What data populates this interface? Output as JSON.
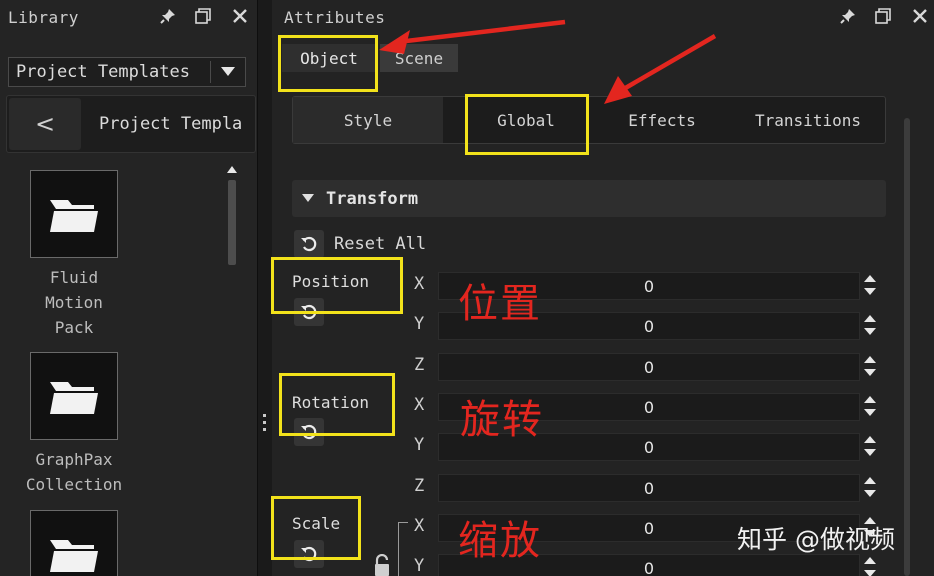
{
  "library": {
    "title": "Library",
    "dropdown_value": "Project Templates",
    "back_label": "<",
    "path": "Project Templa",
    "items": [
      {
        "label": "Fluid\nMotion\nPack",
        "icon": "folder-icon"
      },
      {
        "label": "GraphPax\nCollection",
        "icon": "folder-icon"
      },
      {
        "label": "",
        "icon": "folder-icon"
      }
    ]
  },
  "attributes": {
    "title": "Attributes",
    "tabs": {
      "object": "Object",
      "scene": "Scene"
    },
    "subtabs": {
      "style": "Style",
      "global": "Global",
      "effects": "Effects",
      "transitions": "Transitions"
    },
    "section_title": "Transform",
    "reset_all": "Reset All",
    "groups": {
      "position": "Position",
      "rotation": "Rotation",
      "scale": "Scale"
    },
    "rows": [
      {
        "axis": "X",
        "value": "0"
      },
      {
        "axis": "Y",
        "value": "0"
      },
      {
        "axis": "Z",
        "value": "0"
      },
      {
        "axis": "X",
        "value": "0"
      },
      {
        "axis": "Y",
        "value": "0"
      },
      {
        "axis": "Z",
        "value": "0"
      },
      {
        "axis": "X",
        "value": "0"
      },
      {
        "axis": "Y",
        "value": "0"
      }
    ]
  },
  "annotations": {
    "position_cn": "位置",
    "rotation_cn": "旋转",
    "scale_cn": "缩放",
    "highlight_color": "#f2e21b",
    "arrow_color": "#e3261f"
  },
  "watermark": "知乎 @做视频",
  "icons": {
    "pin": "pin-icon",
    "float": "float-window-icon",
    "close": "close-icon",
    "reset": "reset-icon",
    "lock": "lock-icon"
  }
}
